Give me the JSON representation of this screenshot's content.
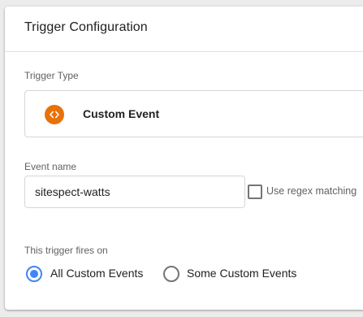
{
  "panel": {
    "title": "Trigger Configuration"
  },
  "trigger_type": {
    "label": "Trigger Type",
    "name": "Custom Event",
    "icon": "code-brackets-icon",
    "icon_color": "#e8710a"
  },
  "event_name": {
    "label": "Event name",
    "value": "sitespect-watts"
  },
  "regex": {
    "label": "Use regex matching",
    "checked": false
  },
  "fires_on": {
    "label": "This trigger fires on",
    "options": [
      {
        "label": "All Custom Events",
        "selected": true
      },
      {
        "label": "Some Custom Events",
        "selected": false
      }
    ],
    "accent_color": "#4285f4"
  }
}
